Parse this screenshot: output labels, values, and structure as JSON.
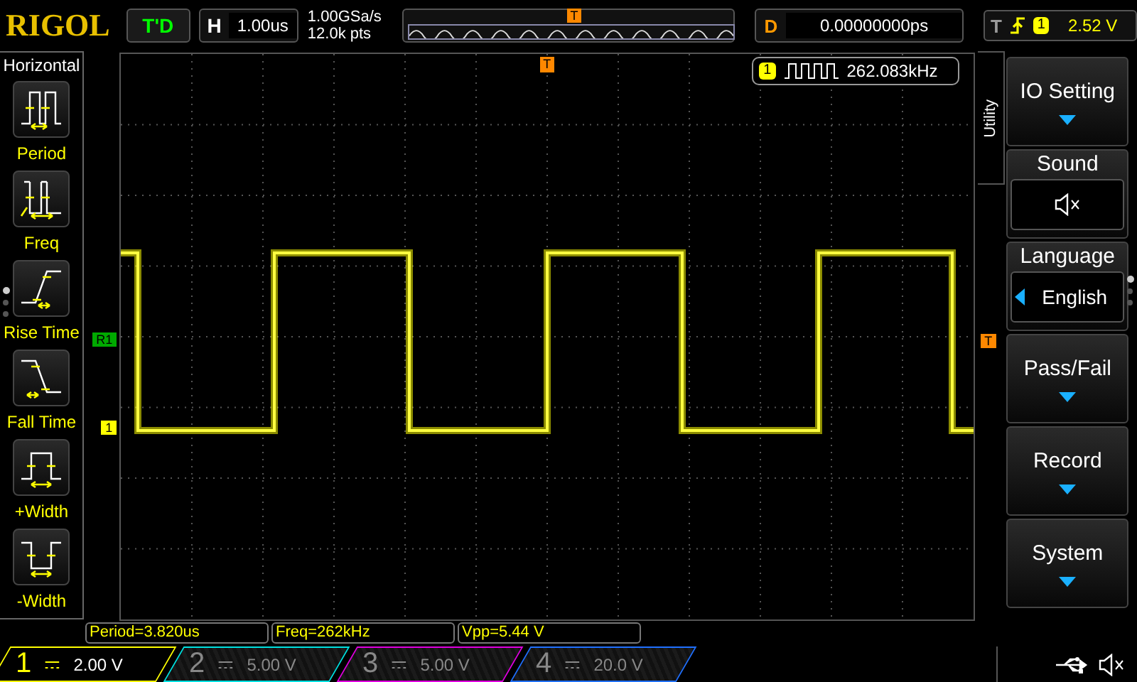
{
  "top_bar": {
    "brand": "RIGOL",
    "run_status": "T'D",
    "horizontal": {
      "label": "H",
      "value": "1.00us"
    },
    "sample_rate": "1.00GSa/s",
    "memory_depth": "12.0k pts",
    "trigger_position_marker": "T",
    "delay": {
      "label": "D",
      "value": "0.00000000ps"
    },
    "trigger": {
      "label": "T",
      "channel": "1",
      "level": "2.52 V"
    }
  },
  "left_menu": {
    "title": "Horizontal",
    "items": [
      {
        "label": "Period",
        "kind": "period"
      },
      {
        "label": "Freq",
        "kind": "freq"
      },
      {
        "label": "Rise Time",
        "kind": "rise"
      },
      {
        "label": "Fall Time",
        "kind": "fall"
      },
      {
        "label": "+Width",
        "kind": "pwidth"
      },
      {
        "label": "-Width",
        "kind": "nwidth"
      }
    ],
    "pages": [
      {
        "selected": true
      },
      {
        "selected": false
      },
      {
        "selected": false
      }
    ]
  },
  "screen": {
    "trigger_position_marker": "T",
    "frequency_counter": {
      "channel": "1",
      "value": "262.083kHz"
    },
    "markers": {
      "reference": "R1",
      "channel": "1",
      "trigger_level": "T"
    }
  },
  "right_menu": {
    "title": "Utility",
    "items": [
      {
        "kind": "submenu",
        "label": "IO Setting"
      },
      {
        "kind": "sound",
        "label": "Sound",
        "muted": true
      },
      {
        "kind": "option",
        "label": "Language",
        "value": "English"
      },
      {
        "kind": "submenu",
        "label": "Pass/Fail"
      },
      {
        "kind": "submenu",
        "label": "Record"
      },
      {
        "kind": "submenu",
        "label": "System"
      }
    ],
    "pages": [
      {
        "selected": true
      },
      {
        "selected": false
      },
      {
        "selected": false
      }
    ]
  },
  "measurements": [
    "Period=3.820us",
    "Freq=262kHz",
    "Vpp=5.44 V"
  ],
  "channels": [
    {
      "number": "1",
      "scale": "2.00 V",
      "on": true,
      "color": "#ffff00"
    },
    {
      "number": "2",
      "scale": "5.00 V",
      "on": false,
      "color": "#00e0e0"
    },
    {
      "number": "3",
      "scale": "5.00 V",
      "on": false,
      "color": "#e000e0"
    },
    {
      "number": "4",
      "scale": "20.0 V",
      "on": false,
      "color": "#2070ff"
    }
  ]
}
